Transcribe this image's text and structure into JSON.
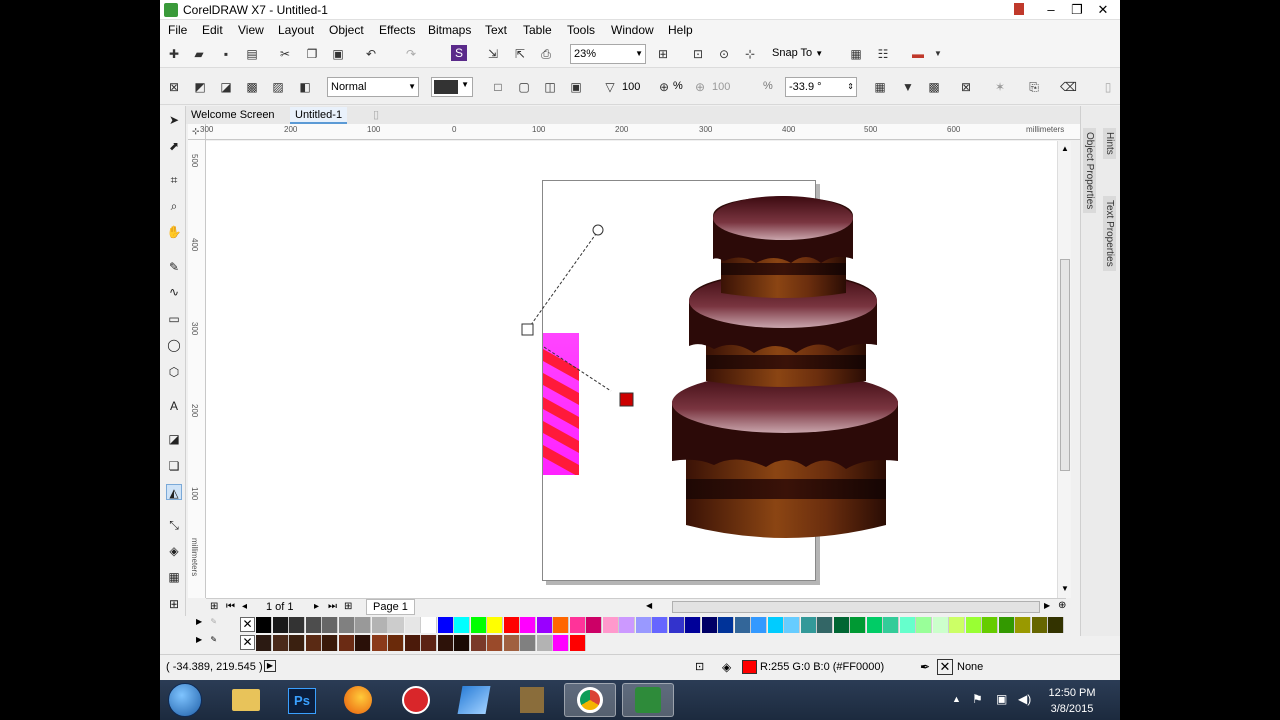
{
  "window": {
    "title": "CorelDRAW X7 - Untitled-1",
    "minimize": "–",
    "maximize": "❐",
    "close": "✕"
  },
  "menu": [
    "File",
    "Edit",
    "View",
    "Layout",
    "Object",
    "Effects",
    "Bitmaps",
    "Text",
    "Table",
    "Tools",
    "Window",
    "Help"
  ],
  "toolbar": {
    "zoom": "23%",
    "snap_to": "Snap To"
  },
  "property_bar": {
    "merge_mode": "Normal",
    "transparency": "100",
    "transparency_unit": "%",
    "transparency2": "100",
    "transparency2_unit": "%",
    "angle": "-33.9 °"
  },
  "tabs": [
    "Welcome Screen",
    "Untitled-1"
  ],
  "ruler": {
    "unit": "millimeters",
    "h_ticks": [
      "300",
      "200",
      "100",
      "0",
      "100",
      "200",
      "300",
      "400",
      "500",
      "600"
    ],
    "v_ticks": [
      "500",
      "400",
      "300",
      "200",
      "100"
    ],
    "v_unit": "millimeters"
  },
  "dockers": {
    "object_properties": "Object Properties",
    "hints": "Hints",
    "text_properties": "Text Properties"
  },
  "page_nav": {
    "count": "1 of 1",
    "page_tab": "Page 1"
  },
  "palette_row1": [
    "#000000",
    "#1a1a1a",
    "#333333",
    "#4d4d4d",
    "#666666",
    "#808080",
    "#999999",
    "#b3b3b3",
    "#cccccc",
    "#e6e6e6",
    "#ffffff",
    "#0000ff",
    "#00ffff",
    "#00ff00",
    "#ffff00",
    "#ff0000",
    "#ff00ff",
    "#9900ff",
    "#ff6600",
    "#ff3399",
    "#cc0066",
    "#ff99cc",
    "#cc99ff",
    "#9999ff",
    "#6666ff",
    "#3333cc",
    "#000099",
    "#000066",
    "#003399",
    "#336699",
    "#3399ff",
    "#00ccff",
    "#66ccff",
    "#339999",
    "#336666",
    "#006633",
    "#009933",
    "#00cc66",
    "#33cc99",
    "#66ffcc",
    "#99ff99",
    "#ccffcc",
    "#ccff66",
    "#99ff33",
    "#66cc00",
    "#339900",
    "#999900",
    "#666600",
    "#333300"
  ],
  "palette_row2": [
    "#2b1a12",
    "#4a2a1a",
    "#3a2010",
    "#5a2a14",
    "#3a1a0a",
    "#6b2b14",
    "#2a1008",
    "#8b3a1a",
    "#6a2a0a",
    "#4b1a0a",
    "#5c2314",
    "#2d1209",
    "#1a0a04",
    "#7a3a2a",
    "#9a4a2a",
    "#a06040",
    "#808080",
    "#b3b3b3",
    "#ff00ff",
    "#ff0000"
  ],
  "status": {
    "coords": "( -34.389, 219.545 )",
    "fill": "R:255 G:0 B:0 (#FF0000)",
    "fill_color": "#ff0000",
    "outline": "None"
  },
  "taskbar": {
    "apps": [
      "windows-start",
      "file-explorer",
      "Ps",
      "firefox",
      "power-app",
      "corel-tool",
      "installer",
      "chrome",
      "coreldraw"
    ],
    "time": "12:50 PM",
    "date": "3/8/2015"
  }
}
